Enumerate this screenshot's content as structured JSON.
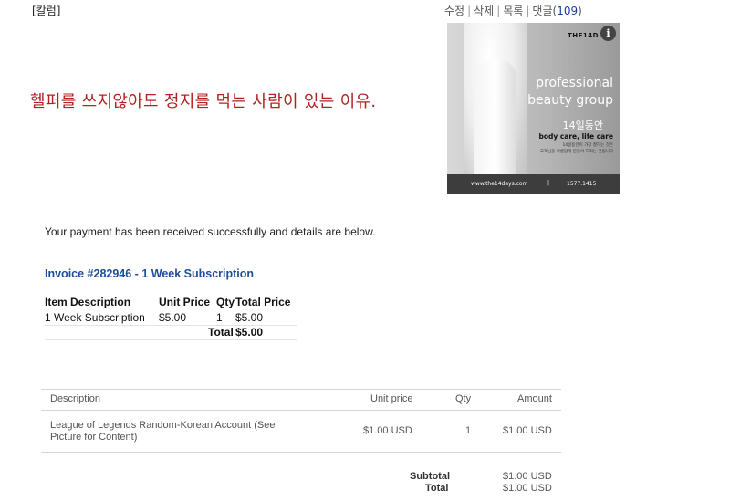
{
  "post": {
    "category": "[칼럼]",
    "actions": {
      "edit": "수정",
      "delete": "삭제",
      "list": "목록",
      "comments_label": "댓글(",
      "comments_count": "109",
      "comments_close": ")"
    },
    "headline": "헬퍼를 쓰지않아도 정지를 먹는 사람이 있는 이유."
  },
  "ad": {
    "logo": "THE14D",
    "info": "i",
    "line1": "professional",
    "line2": "beauty group",
    "line3": "14일동안",
    "line4": "body care, life care",
    "fine1": "14일동안이 가장 잘하는 것은",
    "fine2": "고객님을 아름답게 만들어 드리는 것입니다",
    "url": "www.the14days.com",
    "pipe": "|",
    "phone": "1577.1415"
  },
  "confirmation": {
    "message": "Your payment has been received successfully and details are below.",
    "invoice_title": "Invoice #282946 - 1 Week Subscription",
    "table": {
      "headers": [
        "Item Description",
        "Unit Price",
        "Qty",
        "Total Price"
      ],
      "row": [
        "1 Week Subscription",
        "$5.00",
        "1",
        "$5.00"
      ],
      "total_label": "Total",
      "total_value": "$5.00"
    }
  },
  "purchase": {
    "headers": {
      "description": "Description",
      "unit_price": "Unit price",
      "qty": "Qty",
      "amount": "Amount"
    },
    "row": {
      "description_line1": "League of Legends Random-Korean Account (See",
      "description_line2": "Picture for Content)",
      "unit_price": "$1.00 USD",
      "qty": "1",
      "amount": "$1.00 USD"
    },
    "subtotal_label": "Subtotal",
    "subtotal_value": "$1.00 USD",
    "total_label": "Total",
    "total_value": "$1.00 USD"
  }
}
